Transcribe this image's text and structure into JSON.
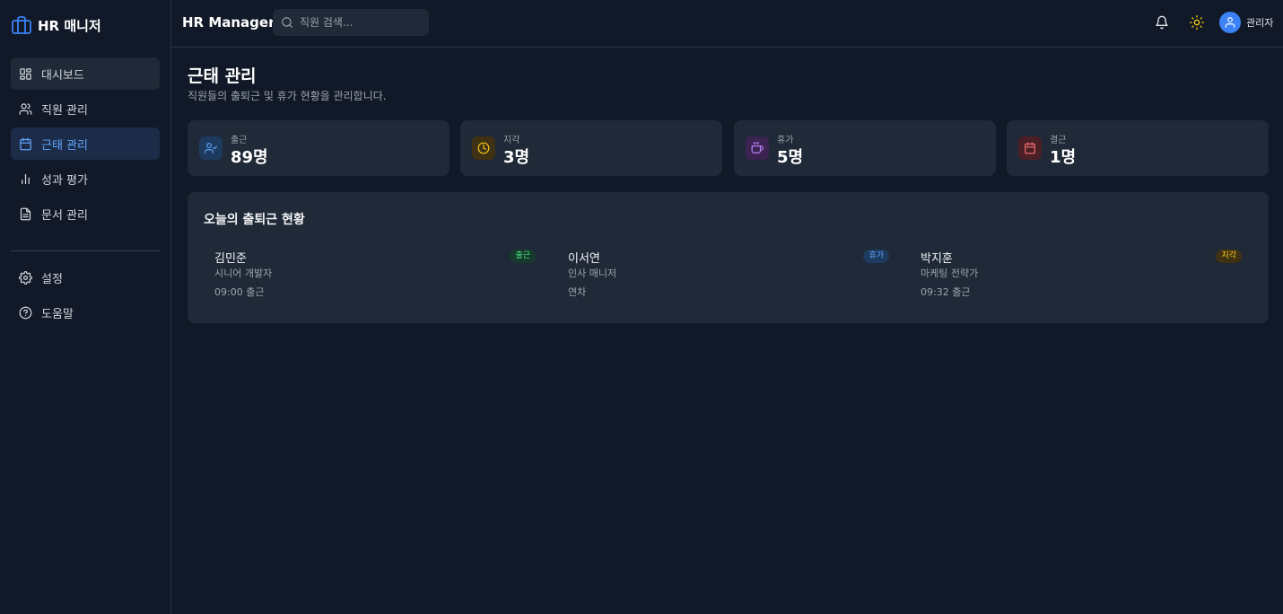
{
  "sidebar": {
    "logo_text": "HR 매니저",
    "items": [
      {
        "label": "대시보드",
        "icon": "dashboard-icon"
      },
      {
        "label": "직원 관리",
        "icon": "users-icon"
      },
      {
        "label": "근태 관리",
        "icon": "calendar-icon"
      },
      {
        "label": "성과 평가",
        "icon": "bar-chart-icon"
      },
      {
        "label": "문서 관리",
        "icon": "document-icon"
      }
    ],
    "bottom_items": [
      {
        "label": "설정",
        "icon": "gear-icon"
      },
      {
        "label": "도움말",
        "icon": "help-icon"
      }
    ]
  },
  "topbar": {
    "brand": "HR Manager",
    "search_placeholder": "직원 검색...",
    "user_name": "관리자"
  },
  "main": {
    "title": "근태 관리",
    "subtitle": "직원들의 출퇴근 및 휴가 현황을 관리합니다."
  },
  "stats": [
    {
      "label": "출근",
      "value": "89명",
      "icon": "user-check-icon",
      "color": "#60a5fa"
    },
    {
      "label": "지각",
      "value": "3명",
      "icon": "clock-icon",
      "color": "#facc15"
    },
    {
      "label": "휴가",
      "value": "5명",
      "icon": "coffee-icon",
      "color": "#c084fc"
    },
    {
      "label": "결근",
      "value": "1명",
      "icon": "calendar-icon",
      "color": "#f87171"
    }
  ],
  "attendance": {
    "title": "오늘의 출퇴근 현황",
    "employees": [
      {
        "name": "김민준",
        "role": "시니어 개발자",
        "detail": "09:00 출근",
        "status": "출근",
        "status_color": "#4ade80"
      },
      {
        "name": "이서연",
        "role": "인사 매니저",
        "detail": "연차",
        "status": "휴가",
        "status_color": "#60a5fa"
      },
      {
        "name": "박지훈",
        "role": "마케팅 전략가",
        "detail": "09:32 출근",
        "status": "지각",
        "status_color": "#facc15"
      }
    ]
  }
}
